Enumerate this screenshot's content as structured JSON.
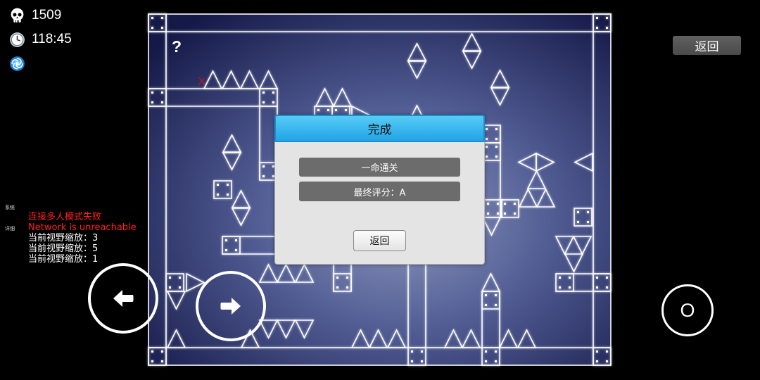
{
  "hud": {
    "deaths": "1509",
    "time": "118:45",
    "icons": {
      "deaths": "skull-icon",
      "time": "clock-icon",
      "ability": "swirl-icon"
    }
  },
  "side_tabs": {
    "system": "系统",
    "detail": "详细"
  },
  "log": {
    "errors": [
      "连接多人模式失败",
      "Network is unreachable"
    ],
    "messages": [
      "当前视野缩放：3",
      "当前视野缩放：5",
      "当前视野缩放：1"
    ]
  },
  "controls": {
    "back_label": "返回",
    "jump_label": "O",
    "left_icon": "arrow-left-icon",
    "right_icon": "arrow-right-icon"
  },
  "board": {
    "hint_mark": "?",
    "death_mark": "X"
  },
  "dialog": {
    "title": "完成",
    "rows": [
      "一命通关",
      "最终评分：A"
    ],
    "button_label": "返回"
  },
  "colors": {
    "background": "#000000",
    "error_text": "#ff2020",
    "death_mark": "#e01010",
    "dialog_header": "#2fb0ec",
    "dialog_row": "#6c6c6c",
    "board_outline": "#ffffff"
  }
}
